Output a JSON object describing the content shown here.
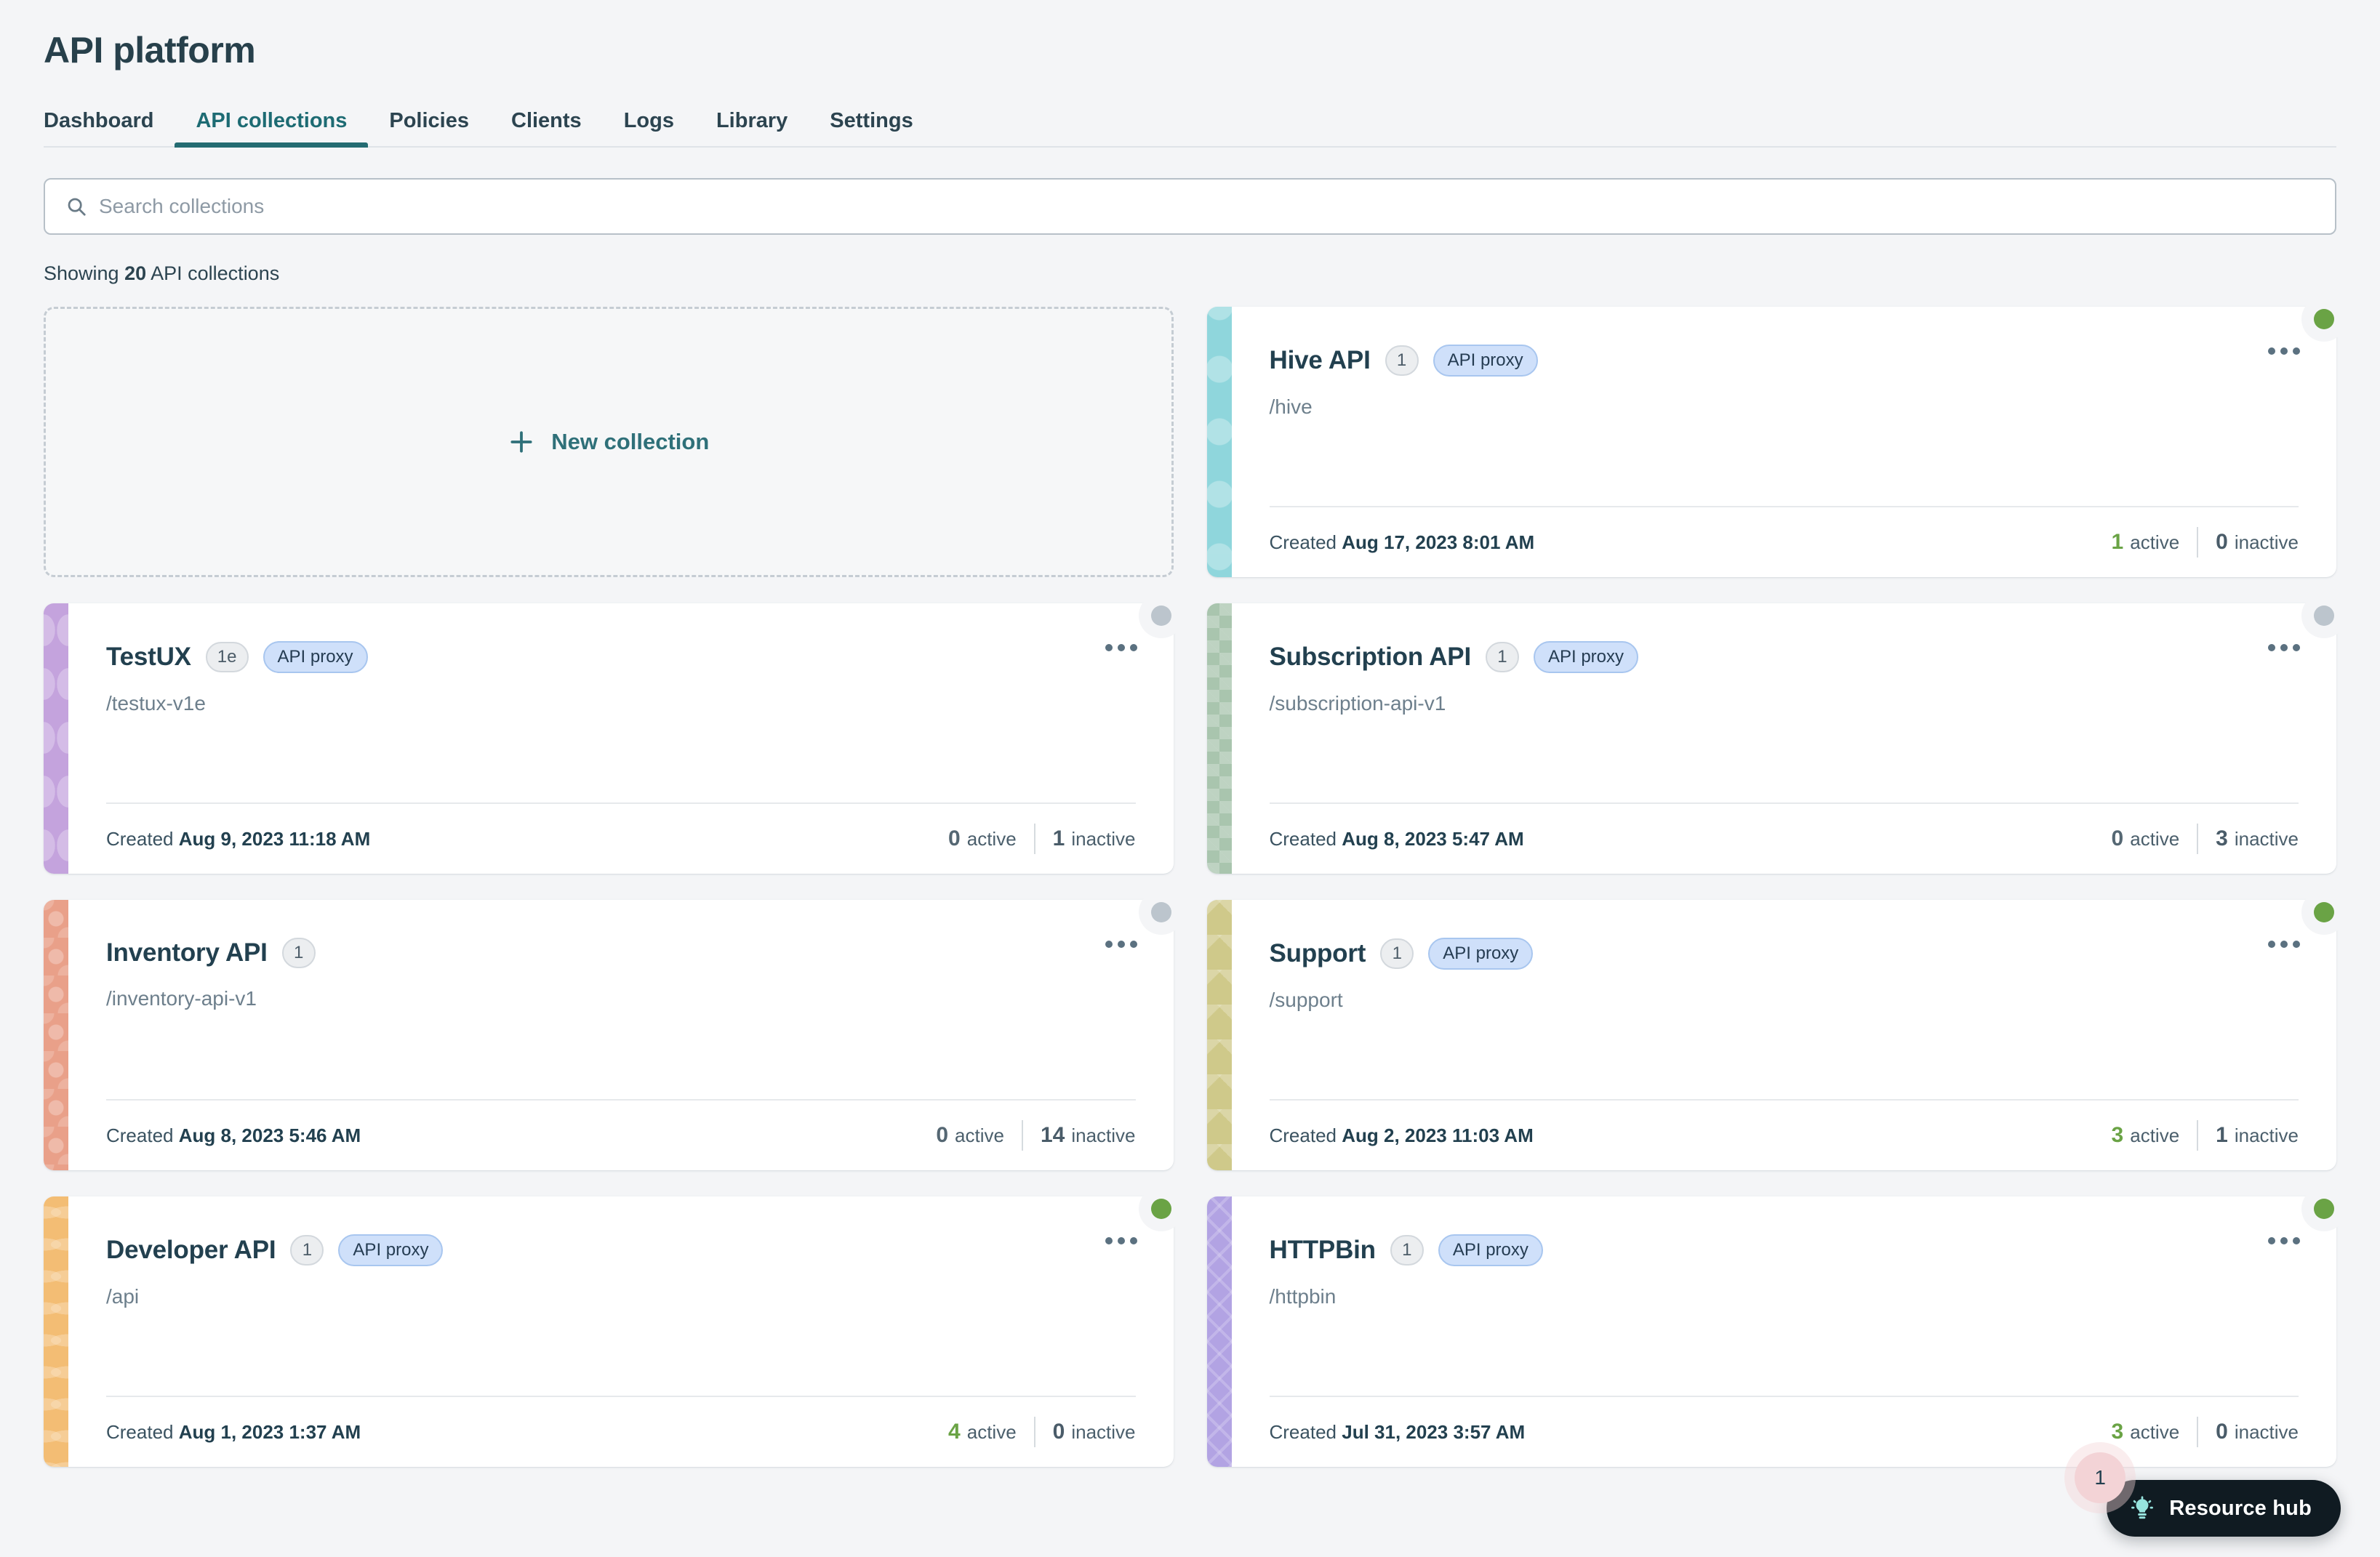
{
  "header": {
    "title": "API platform",
    "tabs": [
      {
        "label": "Dashboard",
        "active": false
      },
      {
        "label": "API collections",
        "active": true
      },
      {
        "label": "Policies",
        "active": false
      },
      {
        "label": "Clients",
        "active": false
      },
      {
        "label": "Logs",
        "active": false
      },
      {
        "label": "Library",
        "active": false
      },
      {
        "label": "Settings",
        "active": false
      }
    ]
  },
  "search": {
    "placeholder": "Search collections",
    "value": "",
    "icon": "search-icon"
  },
  "showing": {
    "prefix": "Showing ",
    "count": "20",
    "suffix": " API collections"
  },
  "new_collection": {
    "label": "New collection",
    "icon": "plus-icon"
  },
  "labels": {
    "created_prefix": "Created ",
    "active": "active",
    "inactive": "inactive",
    "proxy": "API proxy",
    "menu_icon": "kebab-menu-icon"
  },
  "colors": {
    "accent": "#246b72",
    "active_green": "#6aa345",
    "inactive_gray": "#bcc5cd",
    "proxy_pill_bg": "#cfe0fa",
    "page_bg": "#f4f5f7",
    "title": "#22404f"
  },
  "collections": [
    {
      "name": "Hive API",
      "count": "1",
      "proxy": "API proxy",
      "path": "/hive",
      "created": "Aug 17, 2023 8:01 AM",
      "active": "1",
      "inactive": "0",
      "status": "on",
      "stripe_color": "#8fd6dc",
      "pattern": "pat-diamond"
    },
    {
      "name": "TestUX",
      "count": "1e",
      "proxy": "API proxy",
      "path": "/testux-v1e",
      "created": "Aug 9, 2023 11:18 AM",
      "active": "0",
      "inactive": "1",
      "status": "off",
      "stripe_color": "#c4a3dd",
      "pattern": "pat-leaf"
    },
    {
      "name": "Subscription API",
      "count": "1",
      "proxy": "API proxy",
      "path": "/subscription-api-v1",
      "created": "Aug 8, 2023 5:47 AM",
      "active": "0",
      "inactive": "3",
      "status": "off",
      "stripe_color": "#a9c5ae",
      "pattern": "pat-check"
    },
    {
      "name": "Inventory API",
      "count": "1",
      "proxy": "",
      "path": "/inventory-api-v1",
      "created": "Aug 8, 2023 5:46 AM",
      "active": "0",
      "inactive": "14",
      "status": "off",
      "stripe_color": "#e9a089",
      "pattern": "pat-lattice"
    },
    {
      "name": "Support",
      "count": "1",
      "proxy": "API proxy",
      "path": "/support",
      "created": "Aug 2, 2023 11:03 AM",
      "active": "3",
      "inactive": "1",
      "status": "on",
      "stripe_color": "#cfc98a",
      "pattern": "pat-chevron"
    },
    {
      "name": "Developer API",
      "count": "1",
      "proxy": "API proxy",
      "path": "/api",
      "created": "Aug 1, 2023 1:37 AM",
      "active": "4",
      "inactive": "0",
      "status": "on",
      "stripe_color": "#f3bd74",
      "pattern": "pat-wave"
    },
    {
      "name": "HTTPBin",
      "count": "1",
      "proxy": "API proxy",
      "path": "/httpbin",
      "created": "Jul 31, 2023 3:57 AM",
      "active": "3",
      "inactive": "0",
      "status": "on",
      "stripe_color": "#b2a3e3",
      "pattern": "pat-diamond2"
    }
  ],
  "resource_hub": {
    "label": "Resource hub",
    "badge": "1",
    "icon": "lightbulb-icon"
  }
}
